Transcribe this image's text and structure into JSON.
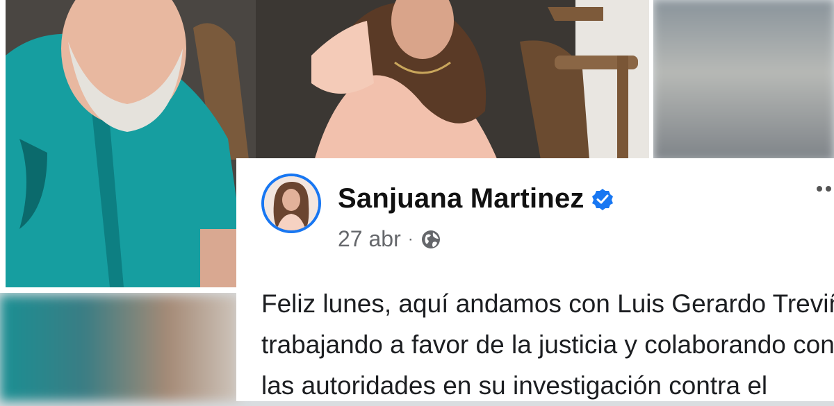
{
  "post": {
    "author": "Sanjuana Martinez",
    "date": "27 abr",
    "separator": "·",
    "verified_icon": "verified-badge-icon",
    "privacy_icon": "globe-icon",
    "lines": [
      "Feliz lunes, aquí andamos con Luis Gerardo Treviño,",
      "trabajando a favor de la justicia y colaborando con",
      "las autoridades en su investigación contra el"
    ]
  },
  "colors": {
    "accent": "#1877f2",
    "text": "#1c1e21",
    "muted": "#65676b"
  }
}
